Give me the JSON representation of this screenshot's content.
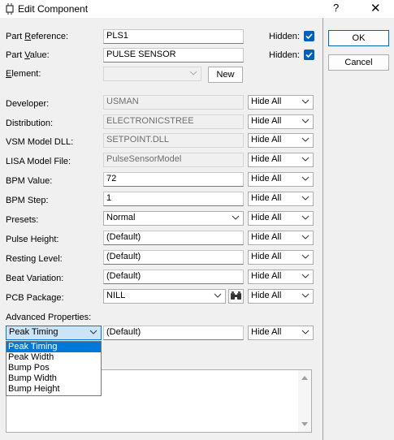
{
  "window": {
    "title": "Edit Component",
    "help_glyph": "?",
    "close_glyph": "✕"
  },
  "fields": {
    "part_reference": {
      "label_pre": "Part ",
      "label_u": "R",
      "label_post": "eference:",
      "value": "PLS1"
    },
    "part_value": {
      "label_pre": "Part ",
      "label_u": "V",
      "label_post": "alue:",
      "value": "PULSE SENSOR"
    },
    "element": {
      "label_u": "E",
      "label_post": "lement:",
      "value": ""
    },
    "developer": {
      "label": "Developer:",
      "value": "USMAN",
      "vis": "Hide All"
    },
    "distribution": {
      "label": "Distribution:",
      "value": "ELECTRONICSTREE",
      "vis": "Hide All"
    },
    "vsm_model": {
      "label": "VSM Model DLL:",
      "value": "SETPOINT.DLL",
      "vis": "Hide All"
    },
    "lisa_model": {
      "label": "LISA Model File:",
      "value": "PulseSensorModel",
      "vis": "Hide All"
    },
    "bpm_value": {
      "label": "BPM Value:",
      "value": "72",
      "vis": "Hide All"
    },
    "bpm_step": {
      "label": "BPM Step:",
      "value": "1",
      "vis": "Hide All"
    },
    "presets": {
      "label": "Presets:",
      "value": "Normal",
      "vis": "Hide All"
    },
    "pulse_height": {
      "label": "Pulse Height:",
      "value": "(Default)",
      "vis": "Hide All"
    },
    "resting_level": {
      "label": "Resting Level:",
      "value": "(Default)",
      "vis": "Hide All"
    },
    "beat_variation": {
      "label": "Beat Variation:",
      "value": "(Default)",
      "vis": "Hide All"
    },
    "pcb_package": {
      "label": "PCB Package:",
      "value": "NILL",
      "vis": "Hide All"
    },
    "advanced": {
      "label": "Advanced Properties:",
      "selected": "Peak Timing",
      "value": "(Default)",
      "vis": "Hide All"
    }
  },
  "hidden_label": "Hidden:",
  "buttons": {
    "ok": "OK",
    "cancel": "Cancel",
    "new": "New"
  },
  "advanced_options": [
    "Peak Timing",
    "Peak Width",
    "Bump Pos",
    "Bump Width",
    "Bump Height"
  ],
  "colors": {
    "accent": "#005fb8",
    "selection": "#0078d7"
  }
}
